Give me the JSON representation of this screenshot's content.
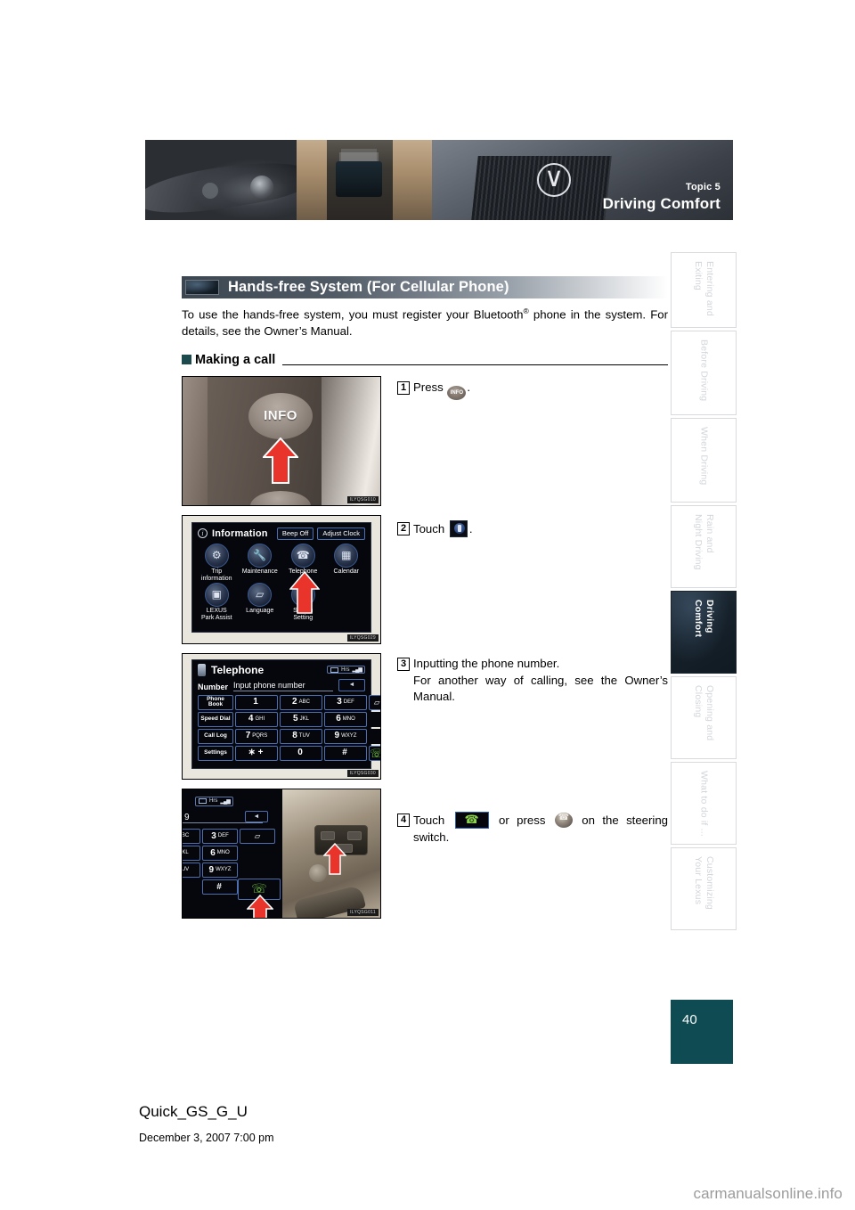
{
  "banner": {
    "topic": "Topic 5",
    "title": "Driving Comfort"
  },
  "sidebar": {
    "items": [
      {
        "label": "Entering and Exiting",
        "active": false
      },
      {
        "label": "Before Driving",
        "active": false
      },
      {
        "label": "When Driving",
        "active": false
      },
      {
        "label": "Rain and\nNight Driving",
        "active": false
      },
      {
        "label": "Driving Comfort",
        "active": true
      },
      {
        "label": "Opening and Closing",
        "active": false
      },
      {
        "label": "What to do if ...",
        "active": false
      },
      {
        "label": "Customizing\nYour Lexus",
        "active": false
      }
    ]
  },
  "section": {
    "title": "Hands-free System (For Cellular Phone)",
    "intro_before": "To use the hands-free system, you must register your Bluetooth",
    "intro_sup": "®",
    "intro_after": " phone in the system. For details, see the Owner’s Manual.",
    "subhead": "Making a call"
  },
  "steps": [
    {
      "num": "1",
      "text_before": "Press ",
      "icon": "info-button-icon",
      "text_after": "."
    },
    {
      "num": "2",
      "text_before": "Touch ",
      "icon": "telephone-tile-icon",
      "text_after": "."
    },
    {
      "num": "3",
      "text_before": "Inputting the phone number.",
      "text_after": "For another way of calling, see the Owner’s Manual."
    },
    {
      "num": "4",
      "text_before": "Touch ",
      "icon": "call-button-icon",
      "text_mid": " or press ",
      "icon2": "steering-phone-button-icon",
      "text_after": " on the steering switch."
    }
  ],
  "figures": {
    "fig1": {
      "code": "ILYQSG010",
      "button_label": "INFO",
      "arrow": "red-up-arrow"
    },
    "fig2": {
      "code": "ILYQSG029",
      "screen_title": "Information",
      "top_buttons": [
        "Beep Off",
        "Adjust Clock"
      ],
      "tiles": [
        {
          "label": "Trip\ninformation",
          "glyph": "⚙"
        },
        {
          "label": "Maintenance",
          "glyph": "🔧"
        },
        {
          "label": "Telephone",
          "glyph": "☎"
        },
        {
          "label": "Calendar",
          "glyph": "▦"
        },
        {
          "label": "LEXUS\nPark Assist",
          "glyph": "▣"
        },
        {
          "label": "Language",
          "glyph": "▱"
        },
        {
          "label": "Screen\nSetting",
          "glyph": "▤"
        }
      ]
    },
    "fig3": {
      "code": "ILYQSG030",
      "screen_title": "Telephone",
      "number_label": "Number",
      "number_placeholder": "Input phone number",
      "status": "Hrs",
      "function_keys": [
        "Phone\nBook",
        "Speed Dial",
        "Call Log",
        "Settings"
      ],
      "keypad": [
        {
          "big": "1",
          "sml": ""
        },
        {
          "big": "2",
          "sml": "ABC"
        },
        {
          "big": "3",
          "sml": "DEF"
        },
        {
          "big": "4",
          "sml": "GHI"
        },
        {
          "big": "5",
          "sml": "JKL"
        },
        {
          "big": "6",
          "sml": "MNO"
        },
        {
          "big": "7",
          "sml": "PQRS"
        },
        {
          "big": "8",
          "sml": "TUV"
        },
        {
          "big": "9",
          "sml": "WXYZ"
        },
        {
          "big": "∗ +",
          "sml": ""
        },
        {
          "big": "0",
          "sml": ""
        },
        {
          "big": "#",
          "sml": ""
        }
      ]
    },
    "fig4": {
      "code": "ILYQSG011",
      "number_value": "9",
      "keys": [
        {
          "big": "",
          "sml": "BC"
        },
        {
          "big": "3",
          "sml": "DEF"
        },
        {
          "big": "",
          "sml": "KL"
        },
        {
          "big": "6",
          "sml": "MNO"
        },
        {
          "big": "",
          "sml": "UV"
        },
        {
          "big": "9",
          "sml": "WXYZ"
        },
        {
          "big": "",
          "sml": ""
        },
        {
          "big": "#",
          "sml": ""
        }
      ]
    }
  },
  "page_number": "40",
  "footer": {
    "file": "Quick_GS_G_U",
    "date": "December 3, 2007 7:00 pm"
  },
  "watermark": "carmanualsonline.info",
  "colors": {
    "page_number_bg": "#0e4b52",
    "subhead_marker": "#1d4a4c",
    "arrow_red": "#e8342a",
    "tab_active_text": "#ffffff"
  }
}
